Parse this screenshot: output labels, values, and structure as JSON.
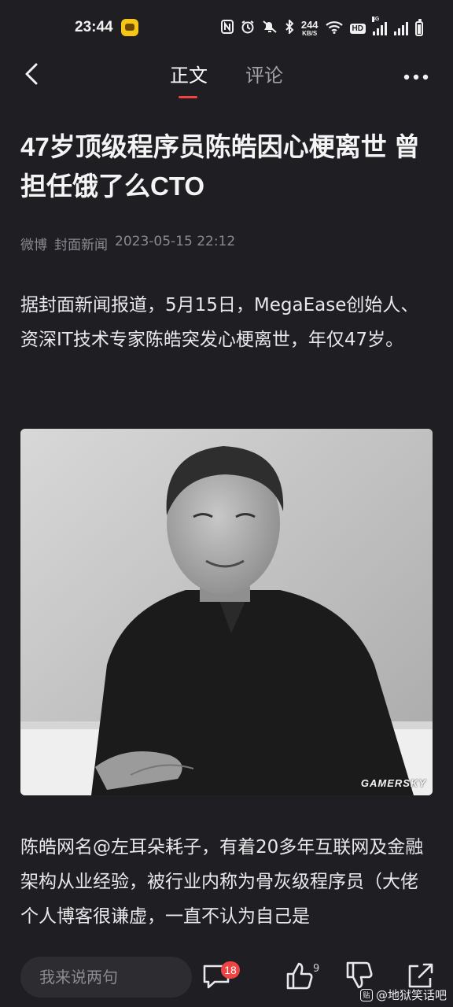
{
  "status_bar": {
    "time": "23:44",
    "net_speed_value": "244",
    "net_speed_unit": "KB/S",
    "hd_badge": "HD",
    "network_label": "4G",
    "icons": [
      "nfc-icon",
      "alarm-icon",
      "mute-icon",
      "bluetooth-icon",
      "wifi-icon",
      "signal-icon",
      "signal-icon",
      "battery-icon"
    ]
  },
  "nav": {
    "tabs": [
      {
        "label": "正文",
        "active": true
      },
      {
        "label": "评论",
        "active": false
      }
    ],
    "accent_color": "#ef4444"
  },
  "article": {
    "title": "47岁顶级程序员陈皓因心梗离世 曾担任饿了么CTO",
    "source": "微博",
    "outlet": "封面新闻",
    "datetime": "2023-05-15 22:12",
    "paragraphs": [
      "据封面新闻报道，5月15日，MegaEase创始人、资深IT技术专家陈皓突发心梗离世，年仅47岁。",
      "陈皓网名@左耳朵耗子，有着20多年互联网及金融架构从业经验，被行业内称为骨灰级程序员（大佬个人博客很谦虚，一直不认为自己是"
    ],
    "image_watermark": "GAMERSKY"
  },
  "bottom_bar": {
    "comment_placeholder": "我来说两句",
    "comment_count": "18",
    "like_count": "9"
  },
  "source_watermark": {
    "badge": "贴",
    "text": "@地狱笑话吧"
  }
}
